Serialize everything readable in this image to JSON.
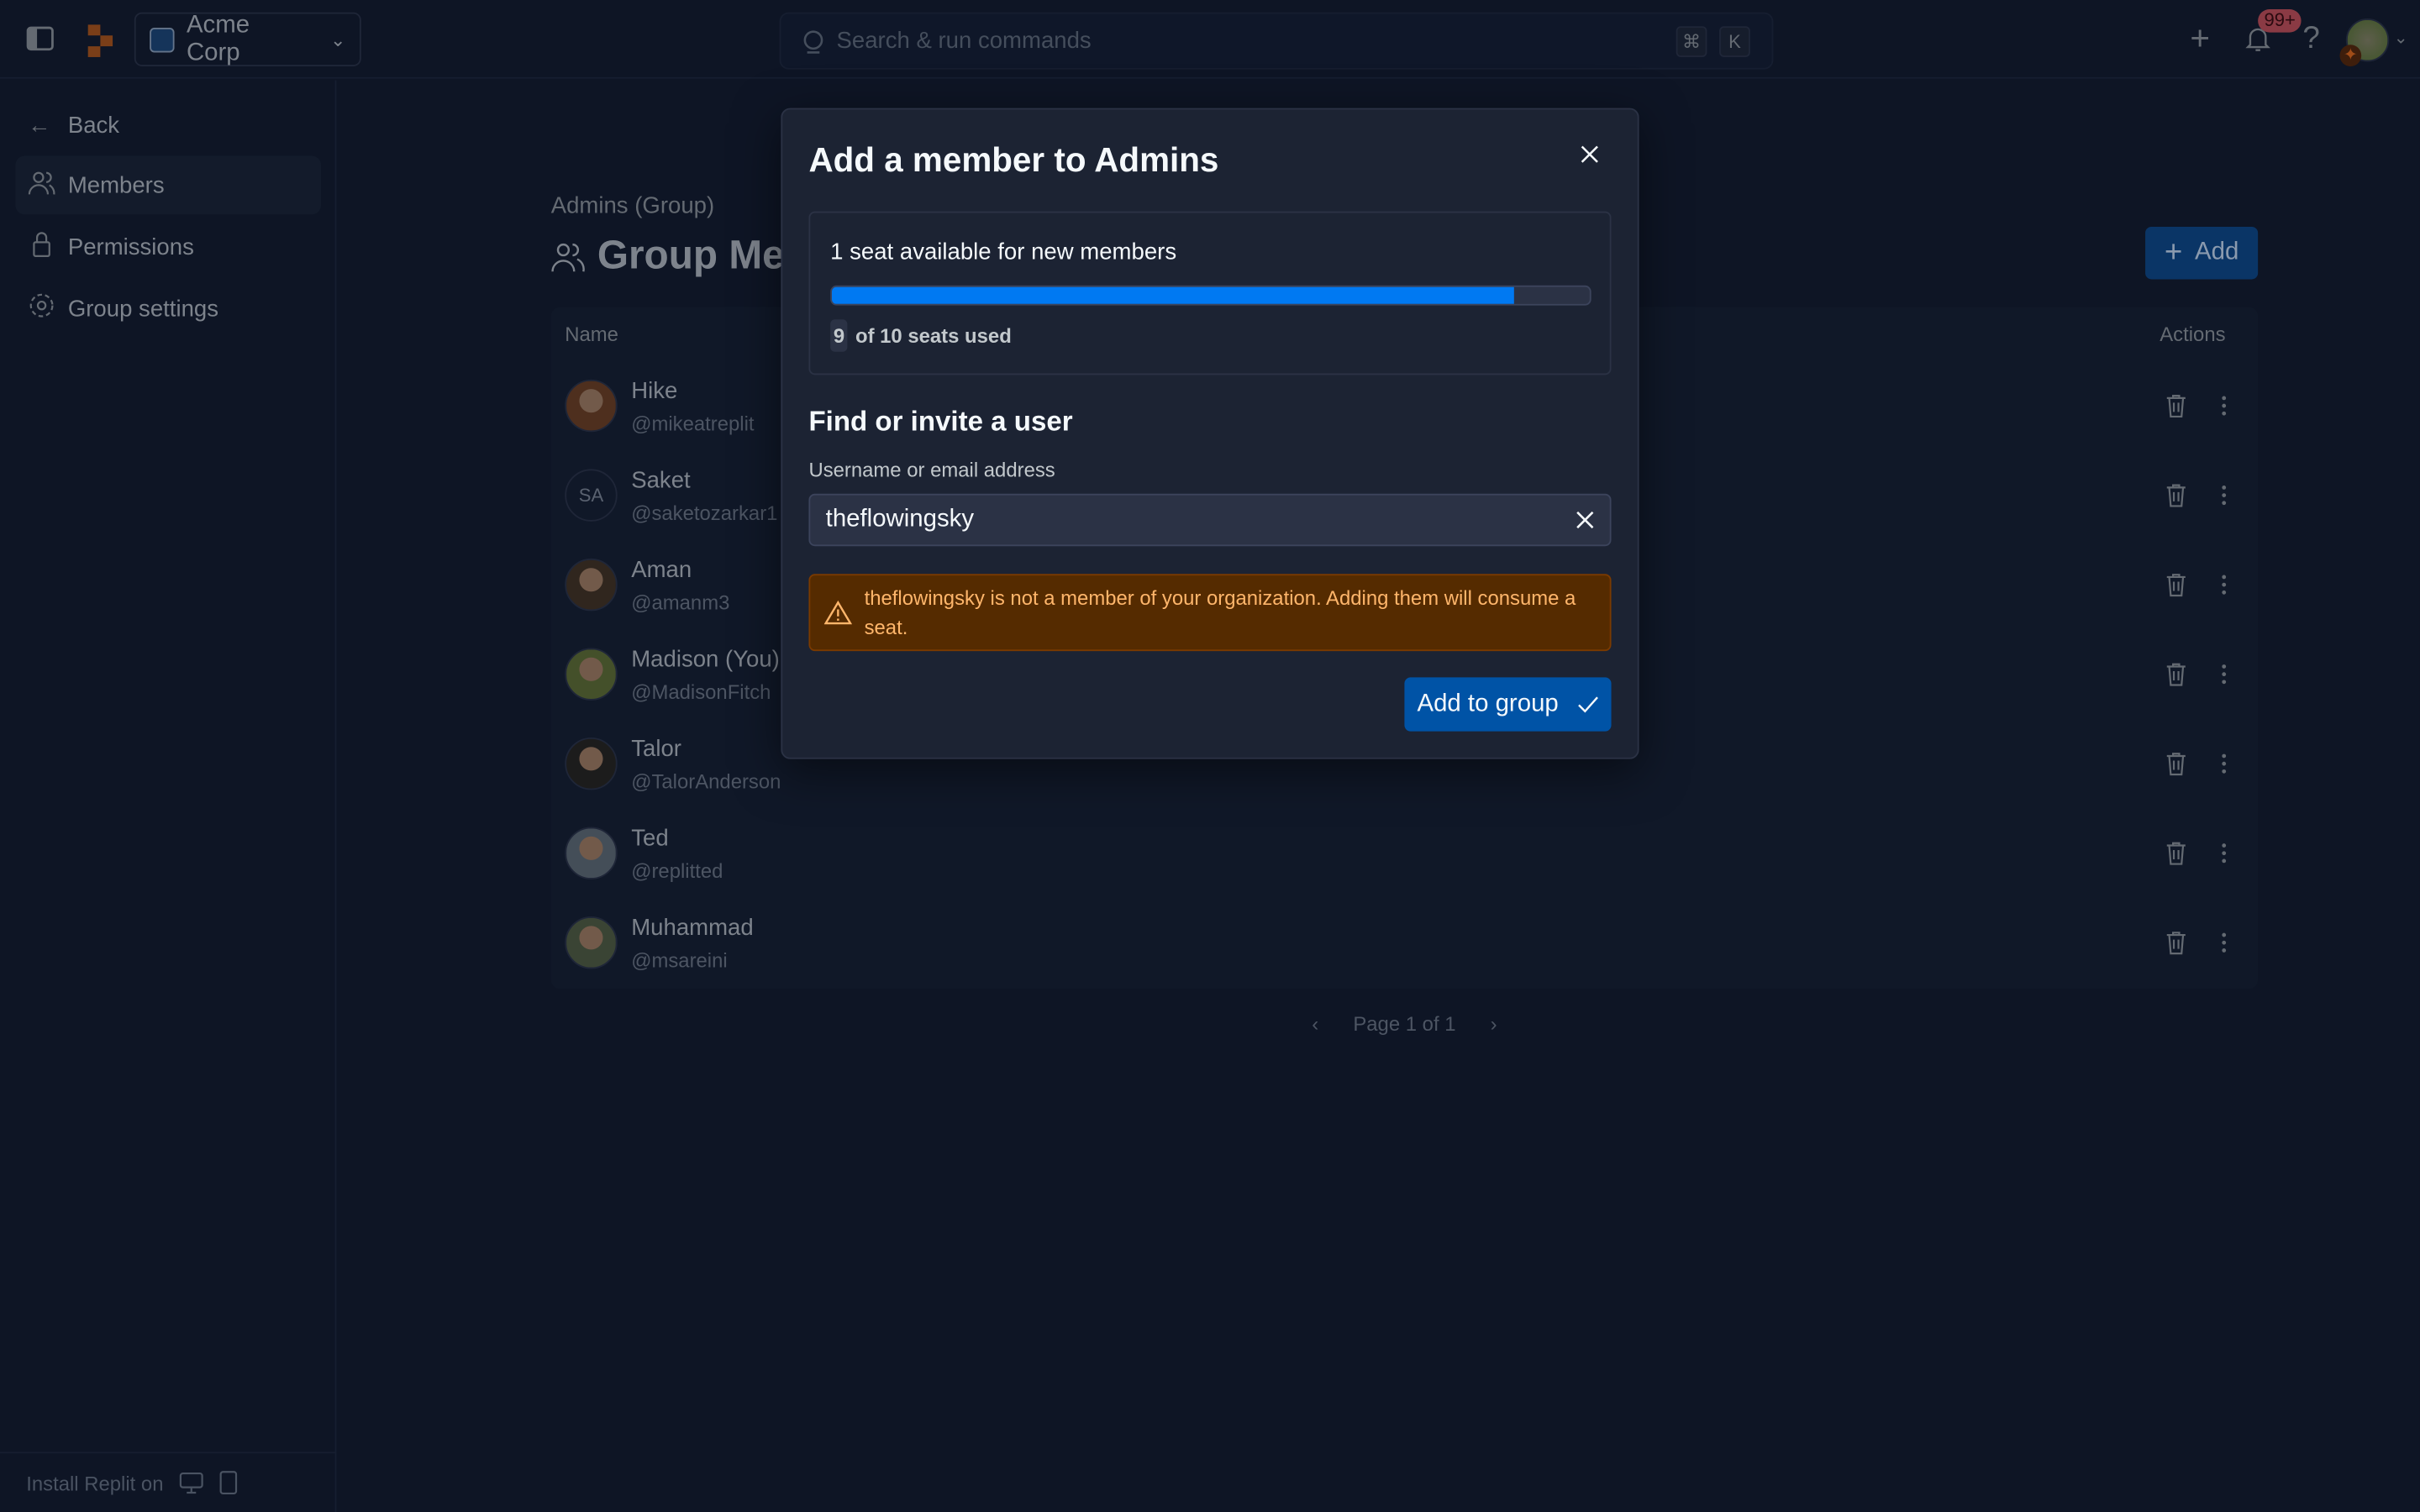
{
  "topbar": {
    "org_name": "Acme Corp",
    "search_placeholder": "Search & run commands",
    "kbd_cmd": "⌘",
    "kbd_k": "K",
    "notification_count": "99+"
  },
  "sidebar": {
    "items": [
      {
        "label": "Back",
        "icon": "arrow-left-icon"
      },
      {
        "label": "Members",
        "icon": "users-icon",
        "active": true
      },
      {
        "label": "Permissions",
        "icon": "lock-icon"
      },
      {
        "label": "Group settings",
        "icon": "gear-icon"
      }
    ],
    "install_label": "Install Replit on"
  },
  "main": {
    "breadcrumb": "Admins (Group)",
    "title": "Group Members",
    "add_label": "Add",
    "table": {
      "headers": {
        "name": "Name",
        "actions": "Actions"
      },
      "rows": [
        {
          "name": "Hike",
          "username": "@mikeatreplit",
          "initials": ""
        },
        {
          "name": "Saket",
          "username": "@saketozarkar1",
          "initials": "SA"
        },
        {
          "name": "Aman",
          "username": "@amanm3",
          "initials": ""
        },
        {
          "name": "Madison (You)",
          "username": "@MadisonFitch",
          "initials": ""
        },
        {
          "name": "Talor",
          "username": "@TalorAnderson",
          "initials": ""
        },
        {
          "name": "Ted",
          "username": "@replitted",
          "initials": ""
        },
        {
          "name": "Muhammad",
          "username": "@msareini",
          "initials": ""
        }
      ]
    },
    "pagination": "Page 1 of 1"
  },
  "modal": {
    "title": "Add a member to Admins",
    "seats_available": "1 seat available for new members",
    "seats_used": "9",
    "seats_total_text": "of 10 seats used",
    "seat_fraction": 0.9,
    "section_title": "Find or invite a user",
    "field_label": "Username or email address",
    "field_value": "theflowingsky",
    "warning": "theflowingsky is not a member of your organization. Adding them will consume a seat.",
    "submit_label": "Add to group"
  },
  "colors": {
    "accent": "#0079f2",
    "button": "#0053a6",
    "warning_bg": "#552b00",
    "warning_text": "#ffb66b",
    "badge": "#a0303a"
  }
}
